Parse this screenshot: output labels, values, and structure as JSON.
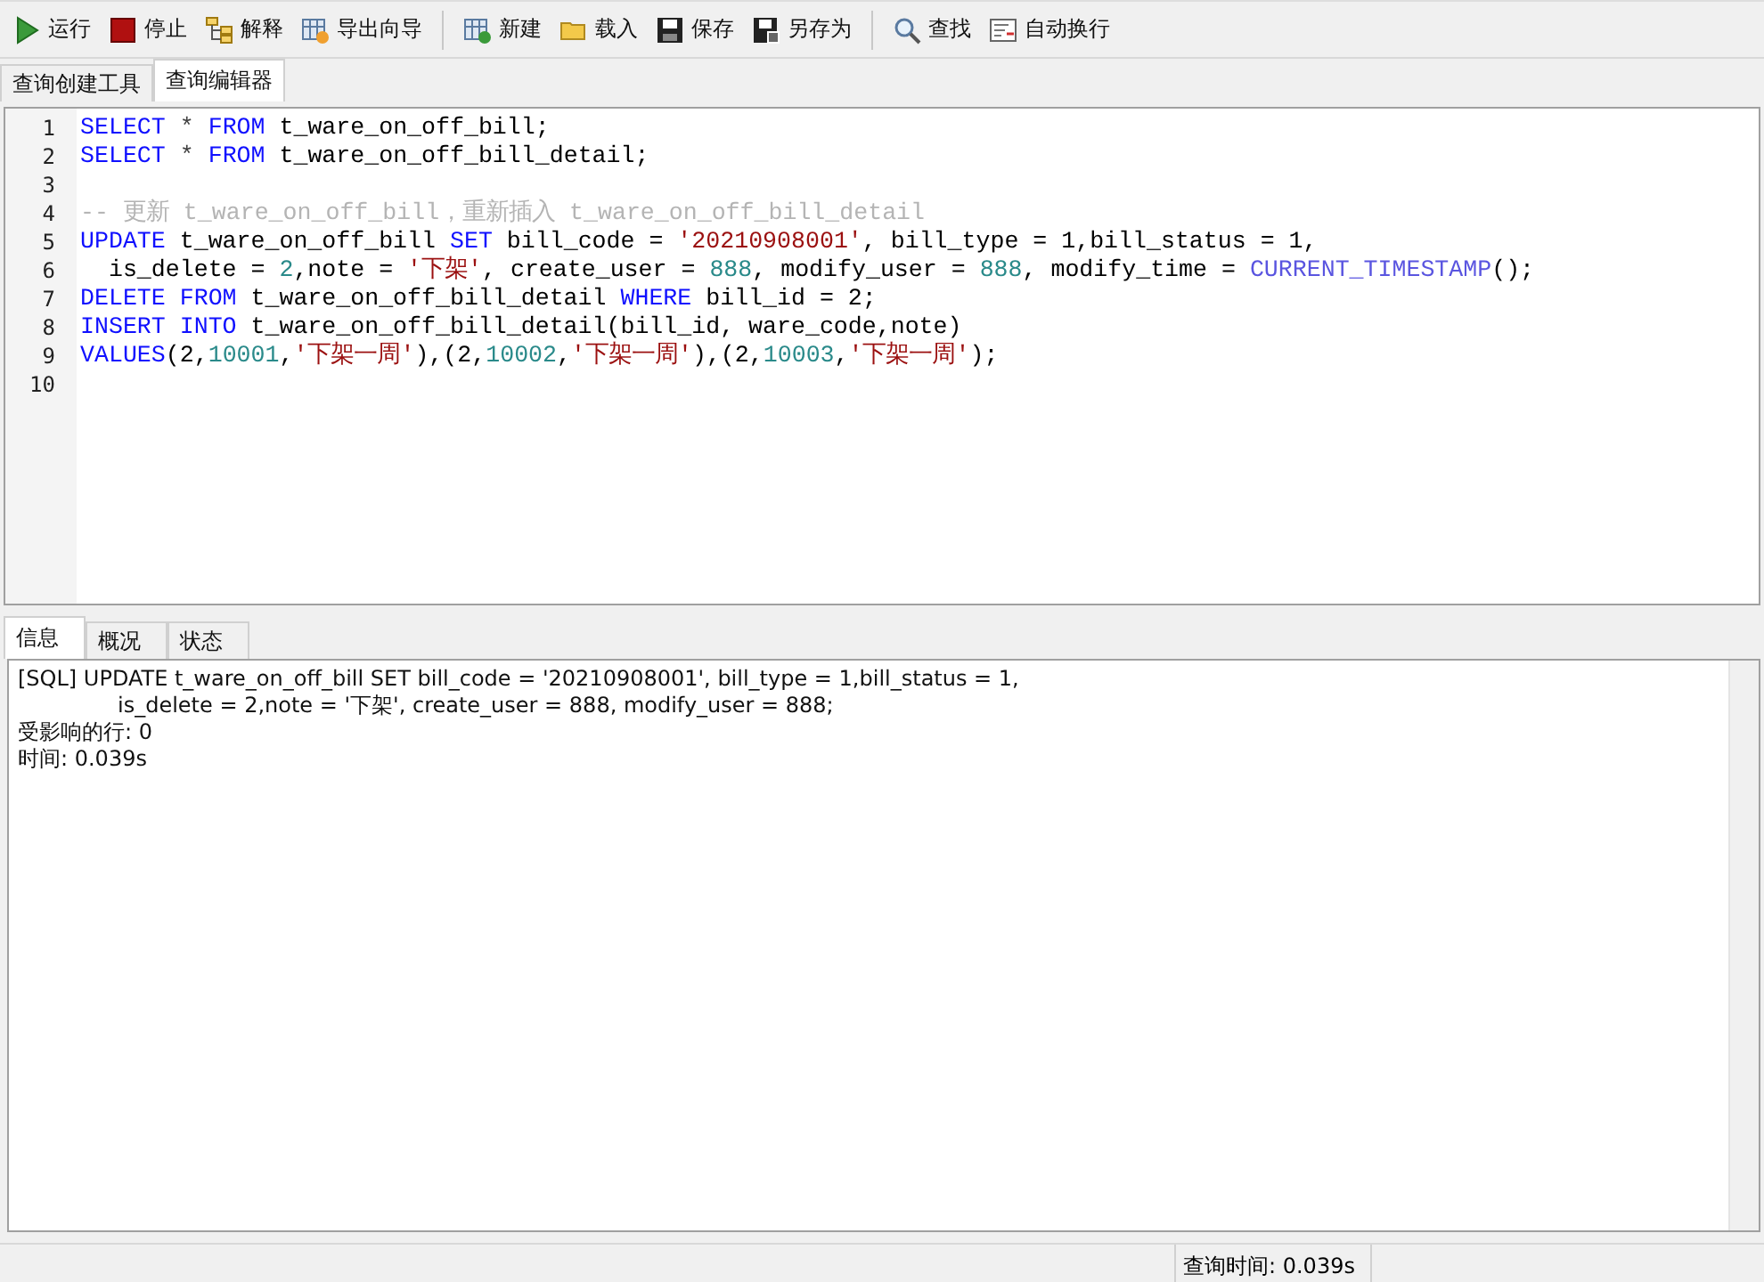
{
  "toolbar": {
    "groups": [
      [
        {
          "label": "运行",
          "kind": "run"
        },
        {
          "label": "停止",
          "kind": "stop"
        },
        {
          "label": "解释",
          "kind": "explain"
        },
        {
          "label": "导出向导",
          "kind": "export"
        }
      ],
      [
        {
          "label": "新建",
          "kind": "new"
        },
        {
          "label": "载入",
          "kind": "folder"
        },
        {
          "label": "保存",
          "kind": "save"
        },
        {
          "label": "另存为",
          "kind": "saveas"
        }
      ],
      [
        {
          "label": "查找",
          "kind": "search"
        },
        {
          "label": "自动换行",
          "kind": "wrap"
        }
      ]
    ]
  },
  "tabs": [
    {
      "label": "查询创建工具",
      "selected": false
    },
    {
      "label": "查询编辑器",
      "selected": true
    }
  ],
  "editor": {
    "lines": [
      {
        "number": "1",
        "tokens": [
          {
            "kind": "kw",
            "t": "SELECT"
          },
          {
            "kind": "op",
            "t": " * "
          },
          {
            "kind": "kw",
            "t": "FROM"
          },
          {
            "kind": "id",
            "t": " t_ware_on_off_bill;"
          }
        ]
      },
      {
        "number": "2",
        "tokens": [
          {
            "kind": "kw",
            "t": "SELECT"
          },
          {
            "kind": "op",
            "t": " * "
          },
          {
            "kind": "kw",
            "t": "FROM"
          },
          {
            "kind": "id",
            "t": " t_ware_on_off_bill_detail;"
          }
        ]
      },
      {
        "number": "3"
      },
      {
        "number": "4",
        "tokens": [
          {
            "kind": "cmt",
            "t": "-- 更新 t_ware_on_off_bill，重新插入 t_ware_on_off_bill_detail"
          }
        ]
      },
      {
        "number": "5",
        "tokens": [
          {
            "kind": "kw",
            "t": "UPDATE"
          },
          {
            "kind": "id",
            "t": " t_ware_on_off_bill "
          },
          {
            "kind": "kw",
            "t": "SET"
          },
          {
            "kind": "id",
            "t": " bill_code = "
          },
          {
            "kind": "str",
            "t": "'20210908001'"
          },
          {
            "kind": "id",
            "t": ", bill_type = 1,bill_status = 1,"
          }
        ]
      },
      {
        "number": "6",
        "tokens": [
          {
            "kind": "id",
            "t": "  is_delete = "
          },
          {
            "kind": "num",
            "t": "2"
          },
          {
            "kind": "id",
            "t": ",note = "
          },
          {
            "kind": "str",
            "t": "'下架'"
          },
          {
            "kind": "id",
            "t": ", create_user = "
          },
          {
            "kind": "num",
            "t": "888"
          },
          {
            "kind": "id",
            "t": ", modify_user = "
          },
          {
            "kind": "num",
            "t": "888"
          },
          {
            "kind": "id",
            "t": ", modify_time = "
          },
          {
            "kind": "fn",
            "t": "CURRENT_TIMESTAMP"
          },
          {
            "kind": "id",
            "t": "();"
          }
        ]
      },
      {
        "number": "7",
        "tokens": [
          {
            "kind": "kw",
            "t": "DELETE FROM"
          },
          {
            "kind": "id",
            "t": " t_ware_on_off_bill_detail "
          },
          {
            "kind": "kw",
            "t": "WHERE"
          },
          {
            "kind": "id",
            "t": " bill_id = 2;"
          }
        ]
      },
      {
        "number": "8",
        "tokens": [
          {
            "kind": "kw",
            "t": "INSERT INTO"
          },
          {
            "kind": "id",
            "t": " t_ware_on_off_bill_detail(bill_id, ware_code,note)"
          }
        ]
      },
      {
        "number": "9",
        "tokens": [
          {
            "kind": "kw",
            "t": "VALUES"
          },
          {
            "kind": "id",
            "t": "(2,"
          },
          {
            "kind": "num",
            "t": "10001"
          },
          {
            "kind": "id",
            "t": ","
          },
          {
            "kind": "str",
            "t": "'下架一周'"
          },
          {
            "kind": "id",
            "t": "),(2,"
          },
          {
            "kind": "num",
            "t": "10002"
          },
          {
            "kind": "id",
            "t": ","
          },
          {
            "kind": "str",
            "t": "'下架一周'"
          },
          {
            "kind": "id",
            "t": "),(2,"
          },
          {
            "kind": "num",
            "t": "10003"
          },
          {
            "kind": "id",
            "t": ","
          },
          {
            "kind": "str",
            "t": "'下架一周'"
          },
          {
            "kind": "id",
            "t": ");"
          }
        ]
      },
      {
        "number": "10"
      }
    ]
  },
  "result_tabs": [
    {
      "label": "信息",
      "selected": true
    },
    {
      "label": "概况",
      "selected": false
    },
    {
      "label": "状态",
      "selected": false
    }
  ],
  "messages": [
    {
      "text": "[SQL] UPDATE t_ware_on_off_bill SET bill_code = '20210908001', bill_type = 1,bill_status = 1,",
      "indented": false
    },
    {
      "text": "is_delete = 2,note = '下架', create_user = 888, modify_user = 888;",
      "indented": true
    },
    {
      "text": "受影响的行: 0",
      "indented": false
    },
    {
      "text": "时间: 0.039s",
      "indented": false
    }
  ],
  "status_bar": {
    "query_time": "查询时间: 0.039s"
  }
}
